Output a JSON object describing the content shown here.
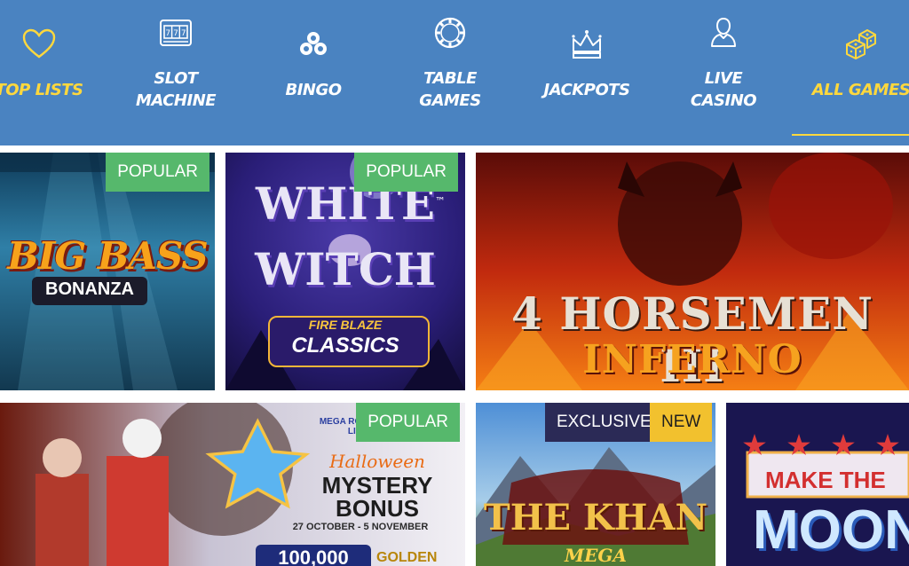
{
  "nav": {
    "items": [
      {
        "label": "TOP LISTS",
        "icon": "heart-icon"
      },
      {
        "label": "SLOT\nMACHINE",
        "icon": "slot-machine-icon"
      },
      {
        "label": "BINGO",
        "icon": "bingo-balls-icon"
      },
      {
        "label": "TABLE\nGAMES",
        "icon": "roulette-chip-icon"
      },
      {
        "label": "JACKPOTS",
        "icon": "crown-icon"
      },
      {
        "label": "LIVE\nCASINO",
        "icon": "person-icon"
      },
      {
        "label": "ALL GAMES",
        "icon": "dice-icon"
      }
    ],
    "colors": {
      "background": "#4a83c1",
      "text": "#ffffff",
      "active": "#ffd83d"
    }
  },
  "tiles": [
    {
      "title_line1": "BIG BASS",
      "title_line2": "BONANZA",
      "badges": [
        "POPULAR"
      ]
    },
    {
      "title_line1": "WHITE",
      "title_line2": "WITCH",
      "subtitle1": "FIRE BLAZE",
      "subtitle2": "CLASSICS",
      "tm": "™",
      "badges": [
        "POPULAR"
      ]
    },
    {
      "title_line1": "4 HORSEMEN III",
      "title_line2": "INFERNO",
      "badges": []
    },
    {
      "title_line1": "MEGA ROULETTE LIVE",
      "title_line2": "Halloween",
      "title_line3": "MYSTERY",
      "title_line4": "BONUS",
      "dates": "27 OCTOBER - 5 NOVEMBER",
      "prize": "100,000",
      "prize_label": "GOLDEN",
      "badges": [
        "POPULAR"
      ]
    },
    {
      "title_line1": "THE KHAN",
      "title_line2": "MEGA",
      "badges": [
        "EXCLUSIVE",
        "NEW"
      ]
    },
    {
      "title_line1": "MAKE THE",
      "title_line2": "MOON",
      "badges": []
    }
  ],
  "badge_colors": {
    "POPULAR": "#56b86c",
    "EXCLUSIVE": "#2b2a56",
    "NEW": "#f2c12e"
  }
}
